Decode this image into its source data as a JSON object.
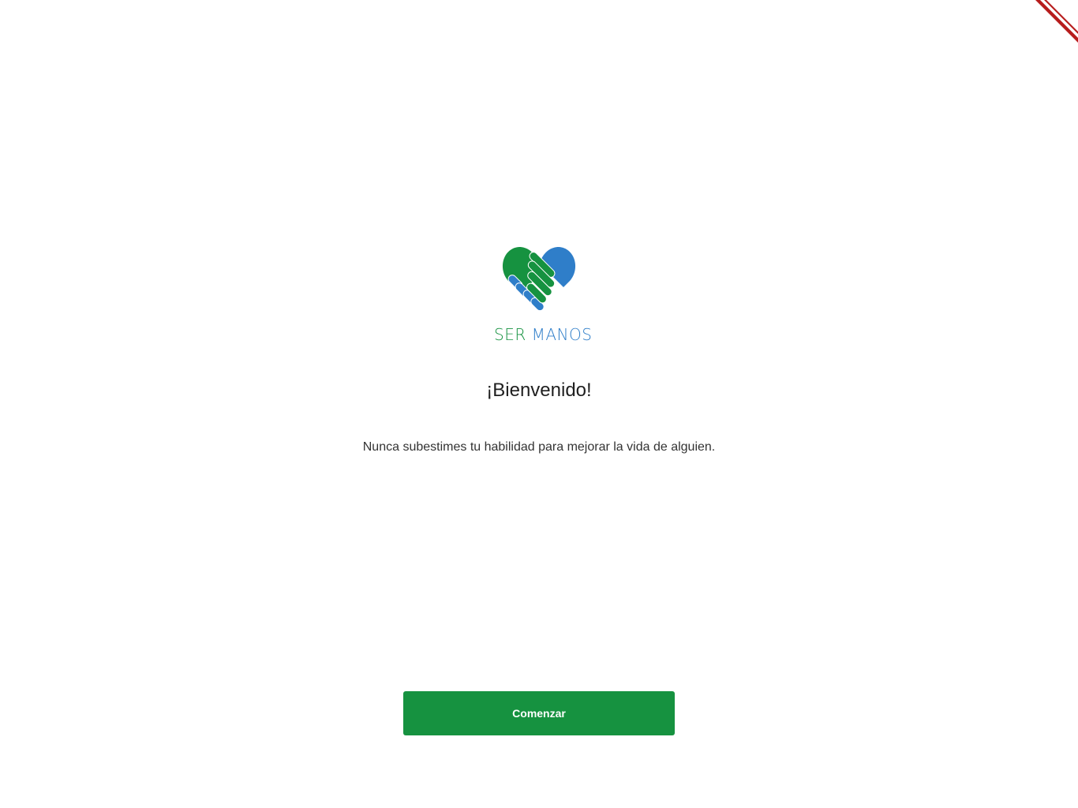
{
  "logo": {
    "icon": "heart-handshake-icon",
    "word_ser": "SER",
    "word_manos": "MANOS",
    "colors": {
      "green": "#169240",
      "blue": "#2f7ec9"
    }
  },
  "welcome": {
    "title": "¡Bienvenido!",
    "subtitle": "Nunca subestimes tu habilidad para mejorar la vida de alguien."
  },
  "actions": {
    "start_label": "Comenzar"
  },
  "colors": {
    "primary": "#169240",
    "debug_banner": "#b71c1c"
  }
}
